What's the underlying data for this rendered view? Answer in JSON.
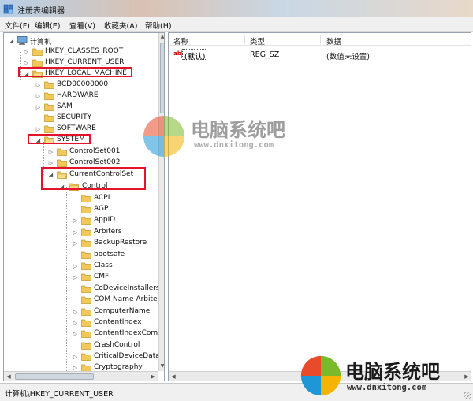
{
  "window": {
    "title": "注册表编辑器"
  },
  "menu": [
    "文件(F)",
    "编辑(E)",
    "查看(V)",
    "收藏夹(A)",
    "帮助(H)"
  ],
  "tree": {
    "root": "计算机",
    "hives": [
      "HKEY_CLASSES_ROOT",
      "HKEY_CURRENT_USER",
      "HKEY_LOCAL_MACHINE"
    ],
    "hklm_children": [
      "BCD00000000",
      "HARDWARE",
      "SAM",
      "SECURITY",
      "SOFTWARE",
      "SYSTEM"
    ],
    "system_children": [
      "ControlSet001",
      "ControlSet002",
      "CurrentControlSet"
    ],
    "control": "Control",
    "control_children": [
      "ACPI",
      "AGP",
      "AppID",
      "Arbiters",
      "BackupRestore",
      "bootsafe",
      "Class",
      "CMF",
      "CoDeviceInstallers",
      "COM Name Arbite",
      "ComputerName",
      "ContentIndex",
      "ContentIndexCom",
      "CrashControl",
      "CriticalDeviceData",
      "Cryptography"
    ]
  },
  "list": {
    "headers": [
      "名称",
      "类型",
      "数据"
    ],
    "rows": [
      {
        "name": "(默认)",
        "type": "REG_SZ",
        "data": "(数值未设置)",
        "icon": "ab-string-icon"
      }
    ]
  },
  "status": {
    "path": "计算机\\HKEY_CURRENT_USER"
  },
  "watermark": {
    "brand": "电脑系统吧",
    "url": "www.dnxitong.com",
    "colors": [
      "#e94b2a",
      "#7ab929",
      "#1f97d7",
      "#f4b400"
    ]
  },
  "highlight_color": "#e4132b"
}
